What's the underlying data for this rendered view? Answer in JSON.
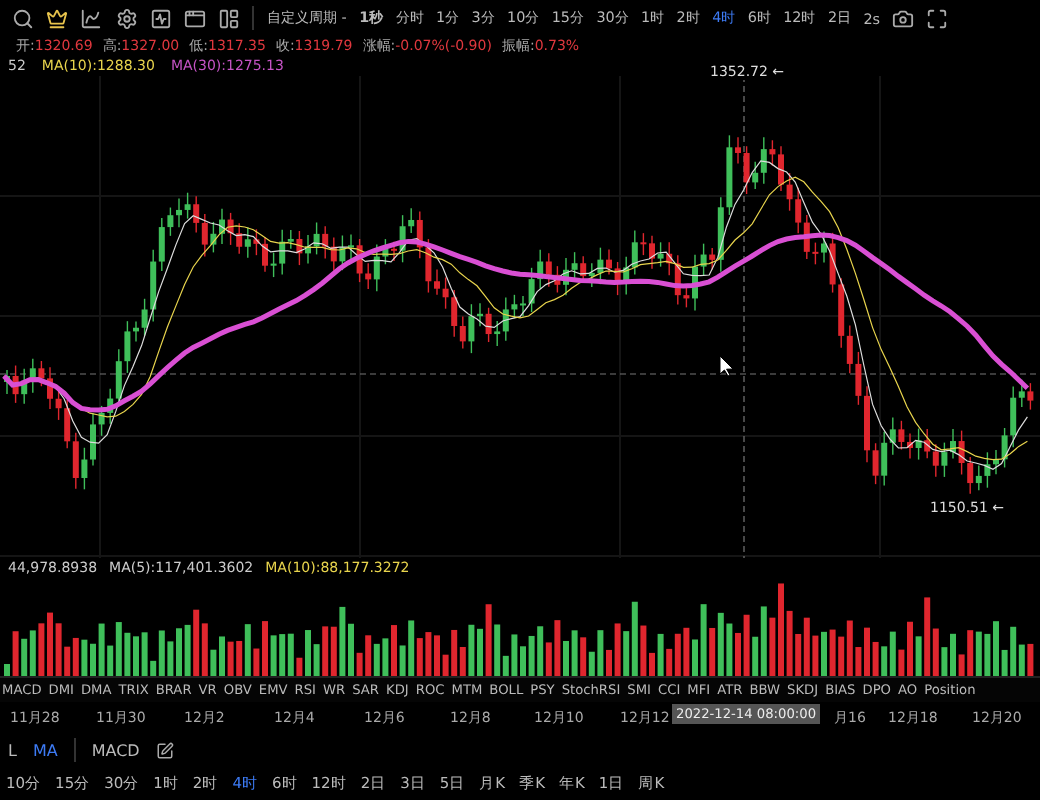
{
  "toolbar": {
    "custom_period": "自定义周期 -",
    "speed": "2s",
    "intervals": [
      {
        "label": "1秒",
        "selected": false
      },
      {
        "label": "分时",
        "selected": false
      },
      {
        "label": "1分",
        "selected": false
      },
      {
        "label": "3分",
        "selected": false
      },
      {
        "label": "10分",
        "selected": false
      },
      {
        "label": "15分",
        "selected": false
      },
      {
        "label": "30分",
        "selected": false
      },
      {
        "label": "1时",
        "selected": false
      },
      {
        "label": "2时",
        "selected": false
      },
      {
        "label": "4时",
        "selected": true
      },
      {
        "label": "6时",
        "selected": false
      },
      {
        "label": "12时",
        "selected": false
      },
      {
        "label": "2日",
        "selected": false
      }
    ]
  },
  "quote": [
    {
      "label": "开:",
      "value": "1320.69"
    },
    {
      "label": "高:",
      "value": "1327.00"
    },
    {
      "label": "低:",
      "value": "1317.35"
    },
    {
      "label": "收:",
      "value": "1319.79"
    },
    {
      "label": "涨幅:",
      "value": "-0.07%(-0.90)"
    },
    {
      "label": "振幅:",
      "value": "0.73%"
    }
  ],
  "ma_legend": [
    {
      "text": "52",
      "color": "#cccccc"
    },
    {
      "text": "MA(10):1288.30",
      "color": "#e8d44d"
    },
    {
      "text": "MA(30):1275.13",
      "color": "#c453c4"
    }
  ],
  "chart": {
    "high_label": "1352.72 ←",
    "low_label": "1150.51 ←"
  },
  "volume_legend": [
    {
      "text": "44,978.8938",
      "color": "#cccccc"
    },
    {
      "text": "MA(5):117,401.3602",
      "color": "#cccccc"
    },
    {
      "text": "MA(10):88,177.3272",
      "color": "#e8d44d"
    }
  ],
  "indicators": [
    "MACD",
    "DMI",
    "DMA",
    "TRIX",
    "BRAR",
    "VR",
    "OBV",
    "EMV",
    "RSI",
    "WR",
    "SAR",
    "KDJ",
    "ROC",
    "MTM",
    "BOLL",
    "PSY",
    "StochRSI",
    "SMI",
    "CCI",
    "MFI",
    "ATR",
    "BBW",
    "SKDJ",
    "BIAS",
    "DPO",
    "AO",
    "Position"
  ],
  "date_axis": {
    "labels": [
      "11月28",
      "11月30",
      "12月2",
      "12月4",
      "12月6",
      "12月8",
      "12月10",
      "12月12",
      "月16",
      "12月18",
      "12月20"
    ],
    "crosshair_time": "2022-12-14 08:00:00"
  },
  "indicator_tabs": [
    {
      "label": "L",
      "selected": false
    },
    {
      "label": "MA",
      "selected": true
    },
    {
      "label": "MACD",
      "selected": false
    }
  ],
  "bottom_intervals": [
    {
      "label": "10分",
      "selected": false
    },
    {
      "label": "15分",
      "selected": false
    },
    {
      "label": "30分",
      "selected": false
    },
    {
      "label": "1时",
      "selected": false
    },
    {
      "label": "2时",
      "selected": false
    },
    {
      "label": "4时",
      "selected": true
    },
    {
      "label": "6时",
      "selected": false
    },
    {
      "label": "12时",
      "selected": false
    },
    {
      "label": "2日",
      "selected": false
    },
    {
      "label": "3日",
      "selected": false
    },
    {
      "label": "5日",
      "selected": false
    },
    {
      "label": "月K",
      "selected": false
    },
    {
      "label": "季K",
      "selected": false
    },
    {
      "label": "年K",
      "selected": false
    },
    {
      "label": "1日",
      "selected": false
    },
    {
      "label": "周K",
      "selected": false
    }
  ]
}
